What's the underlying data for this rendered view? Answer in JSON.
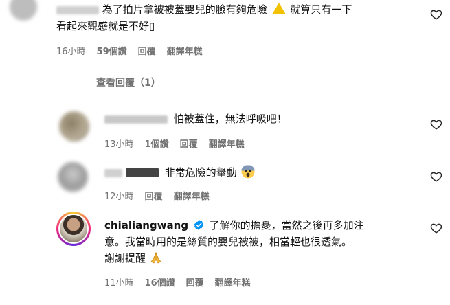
{
  "comment_top": {
    "text_line1": "為了拍片拿被被蓋嬰兒的臉有夠危險",
    "text_after_icon": "就算只有一下",
    "text_line2": "看起來觀感就是不好▯",
    "time": "16小時",
    "likes": "59個讚",
    "reply": "回覆",
    "translate": "翻譯年糕"
  },
  "view_replies": {
    "label": "查看回覆（1）"
  },
  "reply1": {
    "username": "sere",
    "text": "怕被蓋住，無法呼吸吧！",
    "time": "13小時",
    "likes": "1個讚",
    "reply": "回覆",
    "translate": "翻譯年糕"
  },
  "reply2": {
    "text": "非常危險的舉動",
    "time": "12小時",
    "reply": "回覆",
    "translate": "翻譯年糕"
  },
  "reply3": {
    "username": "chialiangwang",
    "text_line1": "了解你的擔憂，當然之後再多加注",
    "text_line2": "意。我當時用的是絲質的嬰兒被被，相當輕也很透氣。",
    "text_line3": "謝謝提醒",
    "time": "11小時",
    "likes": "16個讚",
    "reply": "回覆",
    "translate": "翻譯年糕"
  },
  "icons": {
    "heart": "heart-outline-icon",
    "verified": "verified-badge-icon",
    "warning": "warning-emoji",
    "fearful": "fearful-face-emoji",
    "pray": "folded-hands-emoji"
  },
  "colors": {
    "verified": "#0095f6",
    "meta_gray": "#737373",
    "warning_yellow": "#f2c200"
  }
}
